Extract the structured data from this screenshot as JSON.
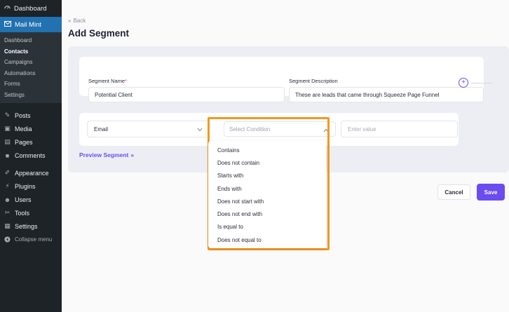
{
  "sidebar": {
    "top": {
      "label": "Dashboard",
      "icon": "dashboard-icon"
    },
    "plugin": {
      "label": "Mail Mint",
      "icon": "mail-icon"
    },
    "submenu": [
      "Dashboard",
      "Contacts",
      "Campaigns",
      "Automations",
      "Forms",
      "Settings"
    ],
    "active_submenu": "Contacts",
    "menu": [
      {
        "label": "Posts",
        "icon": "pin-icon",
        "glyph": "✎"
      },
      {
        "label": "Media",
        "icon": "media-icon",
        "glyph": "▣"
      },
      {
        "label": "Pages",
        "icon": "pages-icon",
        "glyph": "▤"
      },
      {
        "label": "Comments",
        "icon": "comments-icon",
        "glyph": "■"
      }
    ],
    "menu2": [
      {
        "label": "Appearance",
        "icon": "brush-icon",
        "glyph": "✐"
      },
      {
        "label": "Plugins",
        "icon": "plugin-icon",
        "glyph": "⚡"
      },
      {
        "label": "Users",
        "icon": "users-icon",
        "glyph": "☻"
      },
      {
        "label": "Tools",
        "icon": "wrench-icon",
        "glyph": "✂"
      },
      {
        "label": "Settings",
        "icon": "settings-icon",
        "glyph": "▦"
      }
    ],
    "collapse": {
      "label": "Collapse menu",
      "icon": "collapse-icon",
      "glyph": "◀"
    }
  },
  "header": {
    "back_label": "Back",
    "title": "Add Segment"
  },
  "form": {
    "name_label": "Segment Name",
    "name_value": "Potential Client",
    "description_label": "Segment Description",
    "description_value": "These are leads that came through Squeeze Page Funnel"
  },
  "condition": {
    "field_value": "Email",
    "condition_placeholder": "Select Condition",
    "value_placeholder": "Enter value",
    "options": [
      "Contains",
      "Does not contain",
      "Starts with",
      "Ends with",
      "Does not start with",
      "Does not end with",
      "Is equal to",
      "Does not equal to"
    ]
  },
  "preview_label": "Preview Segment",
  "buttons": {
    "cancel": "Cancel",
    "save": "Save"
  },
  "colors": {
    "accent": "#6a4cf0",
    "highlight": "#f29a1e",
    "sidebar": "#1d2327",
    "active_menu": "#2271b1"
  }
}
